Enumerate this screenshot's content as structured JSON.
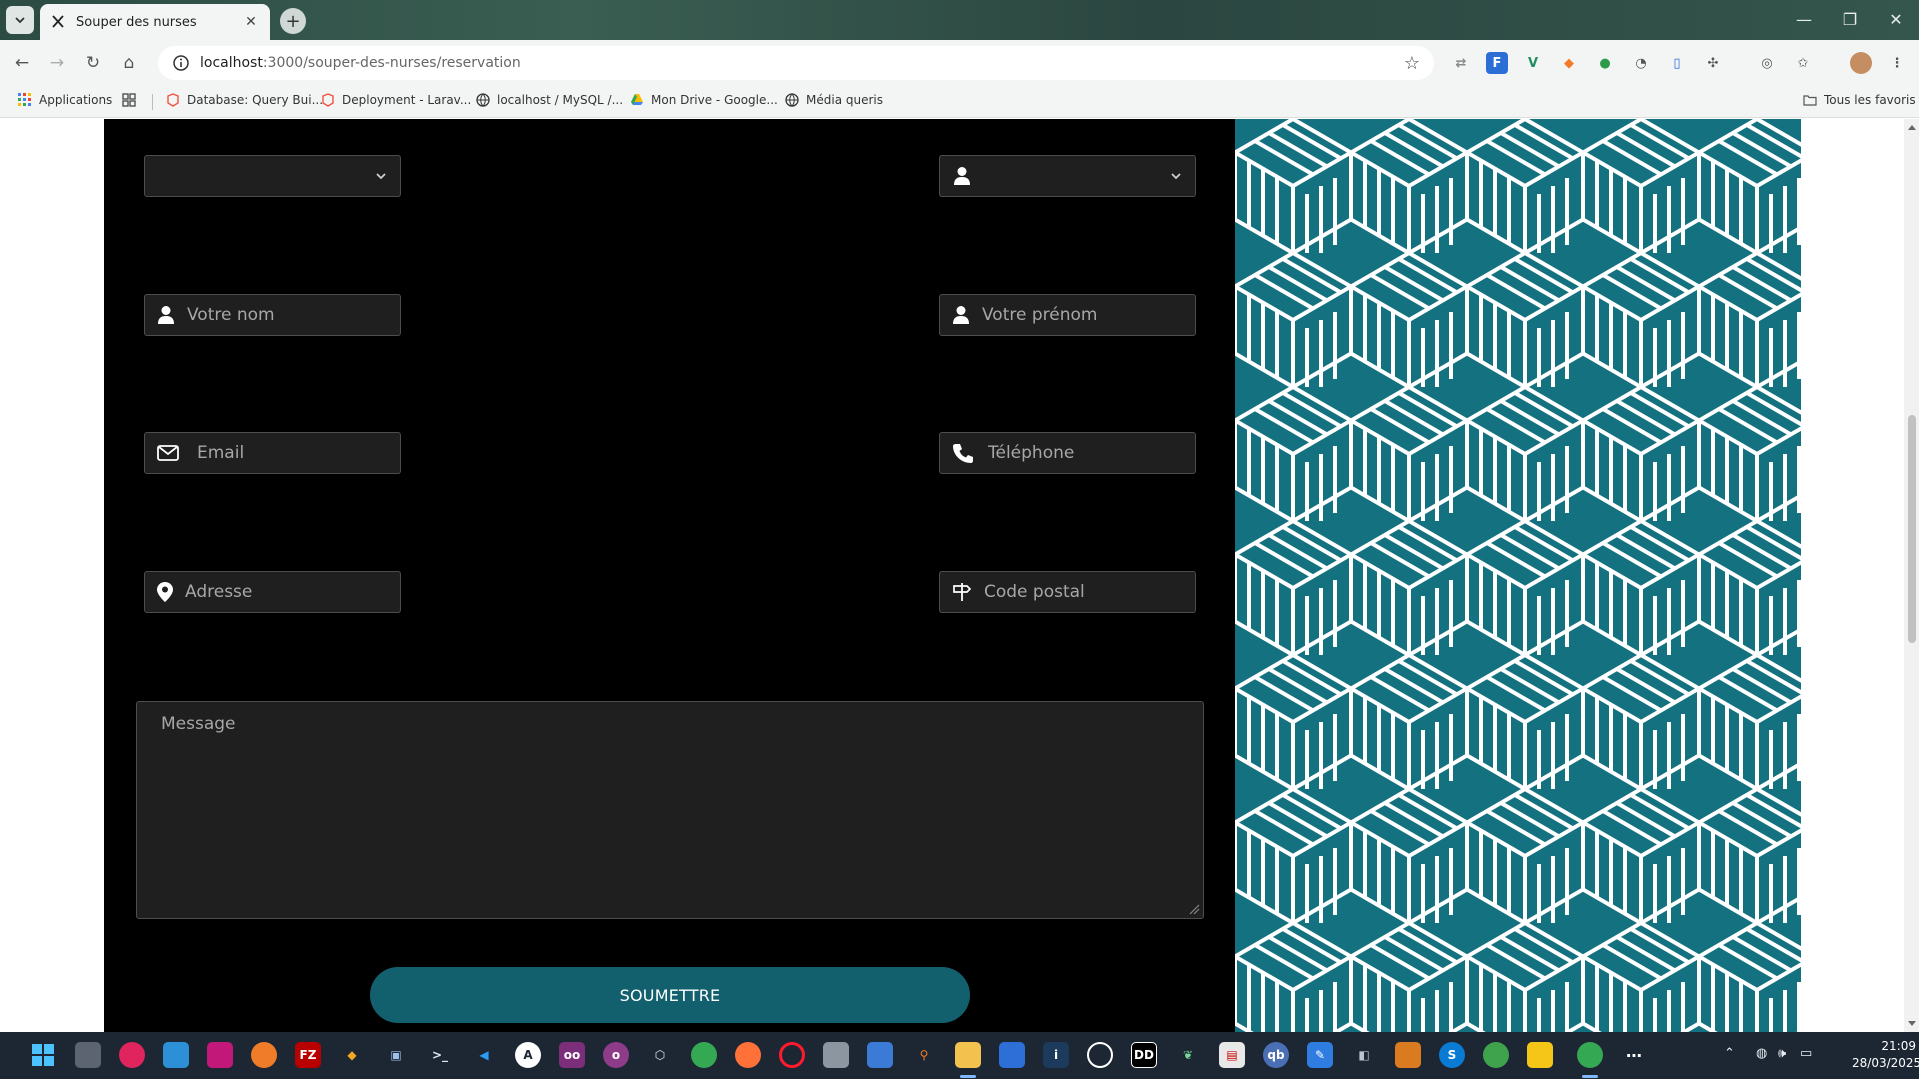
{
  "browser": {
    "tab": {
      "title": "Souper des nurses",
      "close_icon": "close-icon"
    },
    "new_tab_icon": "plus-icon",
    "url": {
      "host": "localhost",
      "rest": ":3000/souper-des-nurses/reservation"
    },
    "bookmarks": [
      {
        "label": "Applications",
        "icon": "apps-grid-icon"
      },
      {
        "label": "Database: Query Bui...",
        "icon": "laravel-icon"
      },
      {
        "label": "Deployment - Larav...",
        "icon": "laravel-icon"
      },
      {
        "label": "localhost / MySQL /...",
        "icon": "globe-icon"
      },
      {
        "label": "Mon Drive - Google...",
        "icon": "drive-icon"
      },
      {
        "label": "Média queris",
        "icon": "globe-icon"
      }
    ],
    "all_bookmarks_label": "Tous les favoris"
  },
  "form": {
    "select_left": {
      "value": ""
    },
    "select_right": {
      "value": ""
    },
    "nom_placeholder": "Votre nom",
    "prenom_placeholder": "Votre prénom",
    "email_placeholder": "Email",
    "telephone_placeholder": "Téléphone",
    "adresse_placeholder": "Adresse",
    "code_postal_placeholder": "Code postal",
    "message_placeholder": "Message",
    "submit_label": "SOUMETTRE"
  },
  "colors": {
    "accent": "#12606e",
    "pattern_bg": "#14717f",
    "panel_bg": "#000000",
    "field_bg": "#1f1f1f"
  },
  "taskbar": {
    "time": "21:09",
    "date": "28/03/2025"
  }
}
